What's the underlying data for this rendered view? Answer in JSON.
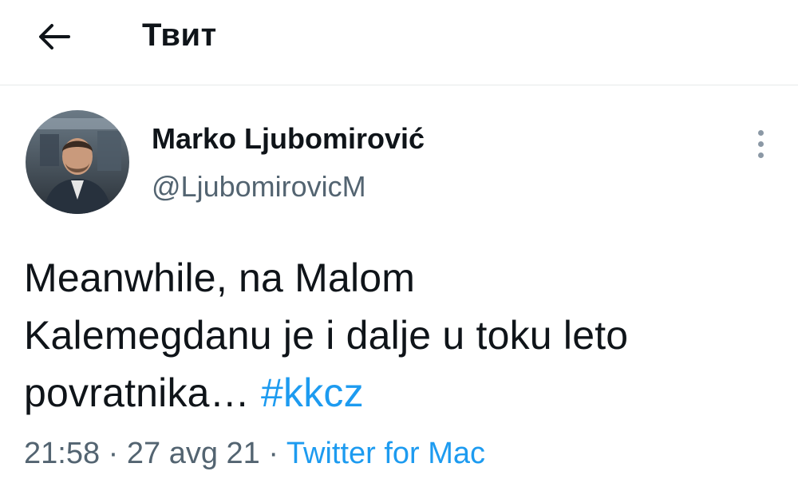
{
  "header": {
    "title": "Твит",
    "back_icon": "arrow-left-icon"
  },
  "author": {
    "name": "Marko Ljubomirović",
    "handle": "@LjubomirovicM",
    "avatar_icon": "user-avatar-photo"
  },
  "menu": {
    "icon": "vertical-dots-icon"
  },
  "tweet": {
    "text_line1": "Meanwhile, na Malom",
    "text_line2": "Kalemegdanu je i dalje u toku leto",
    "text_line3": "povratnika…",
    "hashtag": "#kkcz"
  },
  "meta": {
    "time": "21:58",
    "separator": "·",
    "date": "27 avg 21",
    "source": "Twitter for Mac"
  },
  "colors": {
    "link": "#1d9bf0",
    "text": "#0f1419",
    "secondary": "#536471",
    "divider": "#e6e9ea"
  }
}
